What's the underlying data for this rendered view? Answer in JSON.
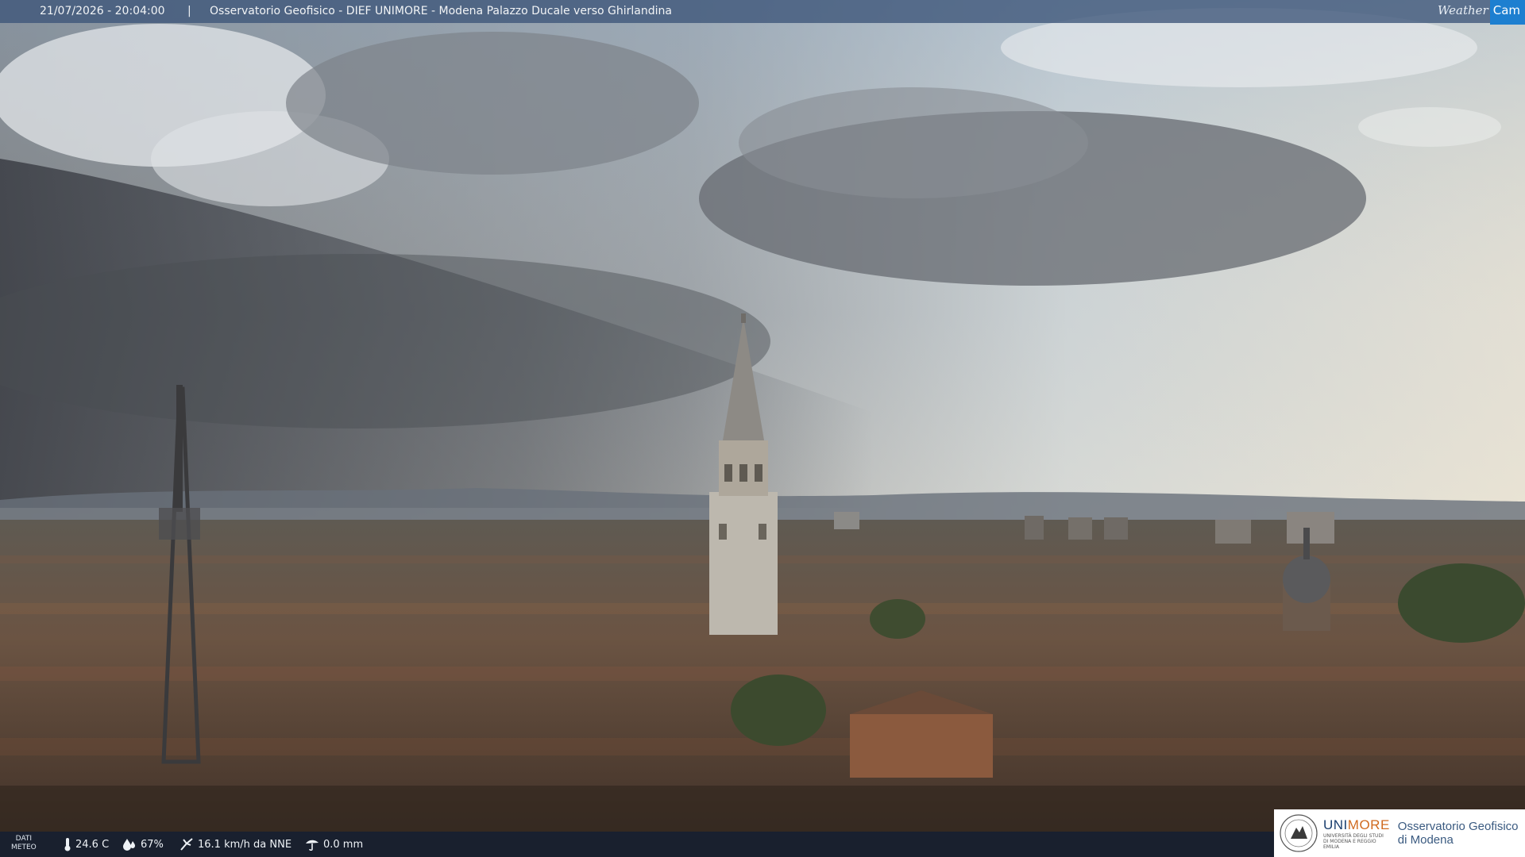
{
  "header": {
    "datetime": "21/07/2026 - 20:04:00",
    "separator": "|",
    "title": "Osservatorio Geofisico - DIEF UNIMORE - Modena Palazzo Ducale verso Ghirlandina",
    "brand_weather": "Weather",
    "brand_cam": "Cam"
  },
  "meteo": {
    "label_line1": "DATI",
    "label_line2": "METEO",
    "temperature": "24.6 C",
    "humidity": "67%",
    "wind": "16.1 km/h da NNE",
    "rain": "0.0 mm",
    "icons": [
      "thermometer-icon",
      "humidity-drop-icon",
      "wind-icon",
      "rain-gauge-icon"
    ]
  },
  "logo": {
    "uni_prefix": "UNI",
    "uni_suffix": "MORE",
    "uni_sub": "UNIVERSITÀ DEGLI STUDI DI MODENA E REGGIO EMILIA",
    "obs_line1": "Osservatorio Geofisico",
    "obs_line2": "di Modena"
  },
  "colors": {
    "header_bg": "#3c5578",
    "brand_blue": "#1d7fd0",
    "unimore_blue": "#1a3e6e",
    "unimore_orange": "#d06a1f"
  }
}
